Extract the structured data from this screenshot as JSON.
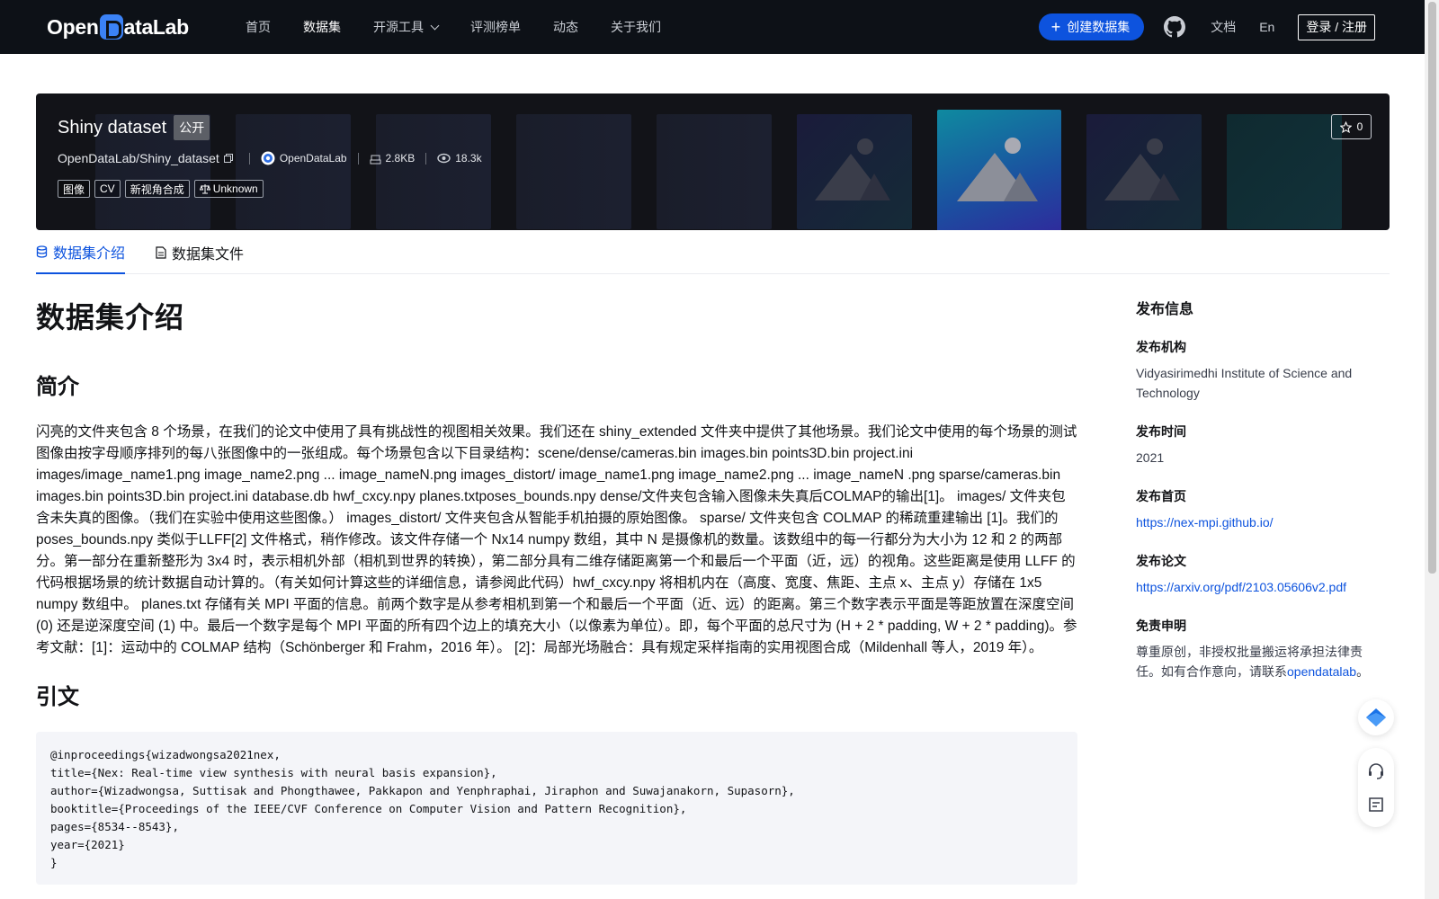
{
  "nav": {
    "logo": "OpenDataLab",
    "items": [
      {
        "label": "首页"
      },
      {
        "label": "数据集"
      },
      {
        "label": "开源工具"
      },
      {
        "label": "评测榜单"
      },
      {
        "label": "动态"
      },
      {
        "label": "关于我们"
      }
    ],
    "create_label": "创建数据集",
    "docs_label": "文档",
    "lang_label": "En",
    "login_label": "登录 / 注册"
  },
  "banner": {
    "name": "Shiny dataset",
    "visibility": "公开",
    "repo": "OpenDataLab/Shiny_dataset",
    "publisher": "OpenDataLab",
    "size": "2.8KB",
    "views": "18.3k",
    "tags": [
      "图像",
      "CV",
      "新视角合成",
      "Unknown"
    ],
    "stars": "0"
  },
  "tabs": [
    {
      "label": "数据集介绍",
      "active": true
    },
    {
      "label": "数据集文件",
      "active": false
    }
  ],
  "content": {
    "title": "数据集介绍",
    "intro_heading": "简介",
    "intro_text": "闪亮的文件夹包含 8 个场景，在我们的论文中使用了具有挑战性的视图相关效果。我们还在 shiny_extended 文件夹中提供了其他场景。我们论文中使用的每个场景的测试图像由按字母顺序排列的每八张图像中的一张组成。每个场景包含以下目录结构：scene/dense/cameras.bin images.bin points3D.bin project.ini images/image_name1.png image_name2.png ... image_nameN.png images_distort/ image_name1.png image_name2.png ... image_nameN .png sparse/cameras.bin images.bin points3D.bin project.ini database.db hwf_cxcy.npy planes.txtposes_bounds.npy dense/文件夹包含输入图像未失真后COLMAP的输出[1]。 images/ 文件夹包含未失真的图像。（我们在实验中使用这些图像。） images_distort/ 文件夹包含从智能手机拍摄的原始图像。 sparse/ 文件夹包含 COLMAP 的稀疏重建输出 [1]。我们的poses_bounds.npy 类似于LLFF[2] 文件格式，稍作修改。该文件存储一个 Nx14 numpy 数组，其中 N 是摄像机的数量。该数组中的每一行都分为大小为 12 和 2 的两部分。第一部分在重新整形为 3x4 时，表示相机外部（相机到世界的转换），第二部分具有二维存储距离第一个和最后一个平面（近，远）的视角。这些距离是使用 LLFF 的代码根据场景的统计数据自动计算的。（有关如何计算这些的详细信息，请参阅此代码）hwf_cxcy.npy 将相机内在（高度、宽度、焦距、主点 x、主点 y）存储在 1x5 numpy 数组中。 planes.txt 存储有关 MPI 平面的信息。前两个数字是从参考相机到第一个和最后一个平面（近、远）的距离。第三个数字表示平面是等距放置在深度空间 (0) 还是逆深度空间 (1) 中。最后一个数字是每个 MPI 平面的所有四个边上的填充大小（以像素为单位）。即，每个平面的总尺寸为 (H + 2 * padding, W + 2 * padding)。参考文献：[1]：运动中的 COLMAP 结构（Schönberger 和 Frahm，2016 年）。 [2]：局部光场融合：具有规定采样指南的实用视图合成（Mildenhall 等人，2019 年）。",
    "citation_heading": "引文",
    "citation_code": "@inproceedings{wizadwongsa2021nex,\ntitle={Nex: Real-time view synthesis with neural basis expansion},\nauthor={Wizadwongsa, Suttisak and Phongthawee, Pakkapon and Yenphraphai, Jiraphon and Suwajanakorn, Supasorn},\nbooktitle={Proceedings of the IEEE/CVF Conference on Computer Vision and Pattern Recognition},\npages={8534--8543},\nyear={2021}\n}"
  },
  "sidebar": {
    "heading": "发布信息",
    "org_label": "发布机构",
    "org_value": "Vidyasirimedhi Institute of Science and Technology",
    "time_label": "发布时间",
    "time_value": "2021",
    "home_label": "发布首页",
    "home_value": "https://nex-mpi.github.io/",
    "paper_label": "发布论文",
    "paper_value": "https://arxiv.org/pdf/2103.05606v2.pdf",
    "disclaimer_label": "免责申明",
    "disclaimer_text": "尊重原创，非授权批量搬运将承担法律责任。如有合作意向，请联系",
    "disclaimer_link": "opendatalab",
    "disclaimer_end": "。"
  },
  "colors": {
    "nav_bg": "#0d1117",
    "accent": "#0d53de",
    "banner_bg": "#121318",
    "code_bg": "#f4f5f9"
  }
}
